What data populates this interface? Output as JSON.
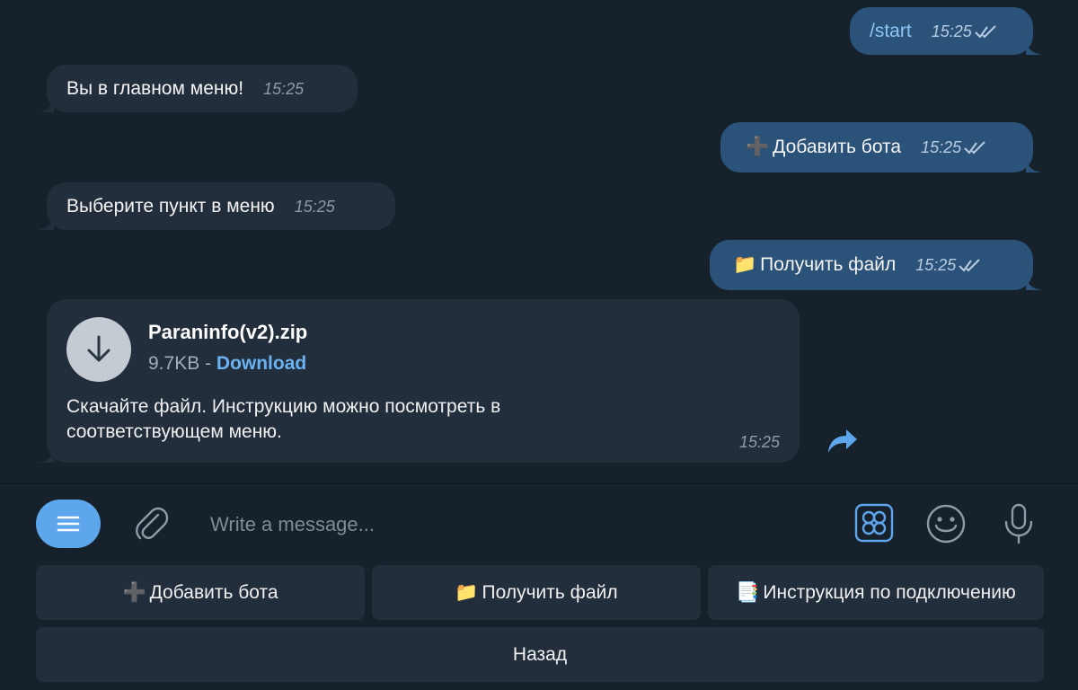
{
  "messages": {
    "start": {
      "text": "/start",
      "time": "15:25"
    },
    "main_menu": {
      "text": "Вы в главном меню!",
      "time": "15:25"
    },
    "add_bot": {
      "emoji": "➕",
      "text": "Добавить бота",
      "time": "15:25"
    },
    "choose_item": {
      "text": "Выберите пункт в меню",
      "time": "15:25"
    },
    "get_file": {
      "emoji": "📁",
      "text": "Получить файл",
      "time": "15:25"
    }
  },
  "file_message": {
    "file_name": "Paraninfo(v2).zip",
    "size": "9.7KB",
    "separator": "-",
    "download_label": "Download",
    "caption": "Скачайте файл. Инструкцию можно посмотреть в соответствующем меню.",
    "time": "15:25"
  },
  "composer": {
    "placeholder": "Write a message..."
  },
  "keyboard": {
    "row1": [
      {
        "emoji": "➕",
        "label": "Добавить бота"
      },
      {
        "emoji": "📁",
        "label": "Получить файл"
      },
      {
        "emoji": "📑",
        "label": "Инструкция по подключению"
      }
    ],
    "back": {
      "label": "Назад"
    }
  },
  "colors": {
    "background": "#17212b",
    "incoming_bubble": "#232e3c",
    "outgoing_bubble": "#2b5278",
    "accent": "#5ea6ec",
    "link": "#6ab3f3"
  },
  "icons": [
    "download-arrow-icon",
    "share-arrow-icon",
    "menu-icon",
    "paperclip-icon",
    "keyboard-icon",
    "emoji-icon",
    "microphone-icon",
    "double-check-icon"
  ]
}
